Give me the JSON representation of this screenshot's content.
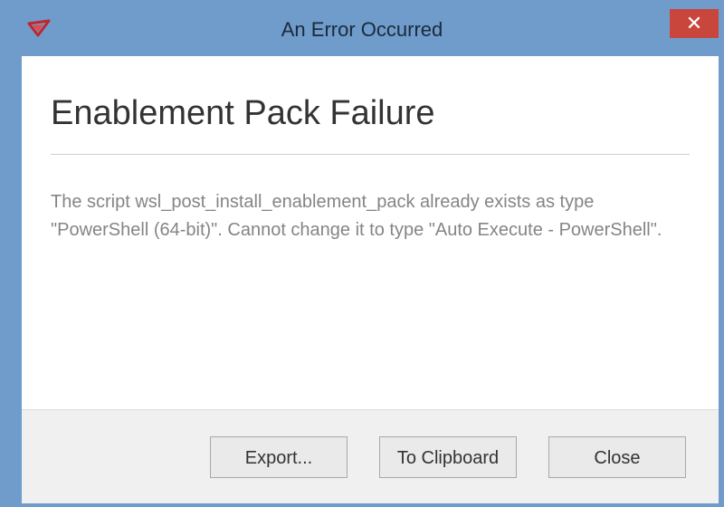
{
  "window": {
    "title": "An Error Occurred",
    "close_glyph": "✕",
    "app_icon": "red-arrow-icon",
    "accent_color": "#6f9ccb",
    "close_color": "#c9463d"
  },
  "dialog": {
    "heading": "Enablement Pack Failure",
    "message": "The script wsl_post_install_enablement_pack already exists as type \"PowerShell (64-bit)\". Cannot change it to type \"Auto Execute - PowerShell\"."
  },
  "buttons": {
    "export_label": "Export...",
    "clipboard_label": "To Clipboard",
    "close_label": "Close"
  }
}
